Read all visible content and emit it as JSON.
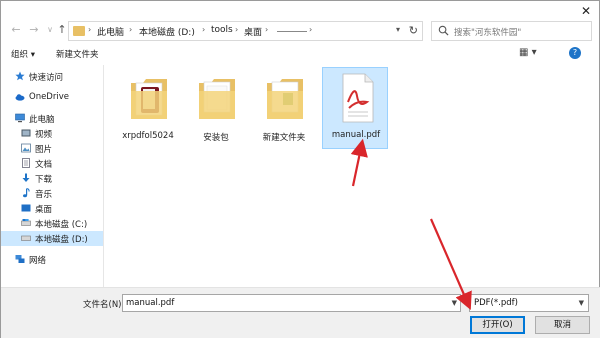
{
  "window": {
    "close_glyph": "✕"
  },
  "address_bar": {
    "breadcrumbs": [
      "此电脑",
      "本地磁盘 (D:)",
      "tools",
      "桌面"
    ],
    "dropdown_glyph": "▾",
    "refresh_glyph": "↻"
  },
  "search": {
    "placeholder": "搜索\"河东软件园\""
  },
  "toolbar": {
    "organize_label": "组织 ▾",
    "new_folder_label": "新建文件夹",
    "view_glyph": "▦ ▾",
    "help_glyph": "?"
  },
  "sidebar": {
    "items": [
      {
        "label": "快速访问",
        "icon": "star-icon"
      },
      {
        "label": "OneDrive",
        "icon": "cloud-icon"
      },
      {
        "label": "此电脑",
        "icon": "computer-icon"
      },
      {
        "label": "视频",
        "icon": "video-icon"
      },
      {
        "label": "图片",
        "icon": "picture-icon"
      },
      {
        "label": "文档",
        "icon": "document-icon"
      },
      {
        "label": "下载",
        "icon": "download-icon"
      },
      {
        "label": "音乐",
        "icon": "music-icon"
      },
      {
        "label": "桌面",
        "icon": "desktop-icon"
      },
      {
        "label": "本地磁盘 (C:)",
        "icon": "drive-icon"
      },
      {
        "label": "本地磁盘 (D:)",
        "icon": "drive-icon"
      },
      {
        "label": "网络",
        "icon": "network-icon"
      }
    ],
    "selected": "本地磁盘 (D:)"
  },
  "files": [
    {
      "name": "xrpdfol5024",
      "kind": "folder"
    },
    {
      "name": "安装包",
      "kind": "folder"
    },
    {
      "name": "新建文件夹",
      "kind": "folder"
    },
    {
      "name": "manual.pdf",
      "kind": "pdf",
      "selected": true
    }
  ],
  "bottom": {
    "filename_label": "文件名(N):",
    "filename_value": "manual.pdf",
    "filetype_value": "PDF(*.pdf)",
    "open_label": "打开(O)",
    "cancel_label": "取消"
  },
  "colors": {
    "selection": "#cce8ff",
    "folder": "#e8c065",
    "arrow": "#d9262b"
  }
}
